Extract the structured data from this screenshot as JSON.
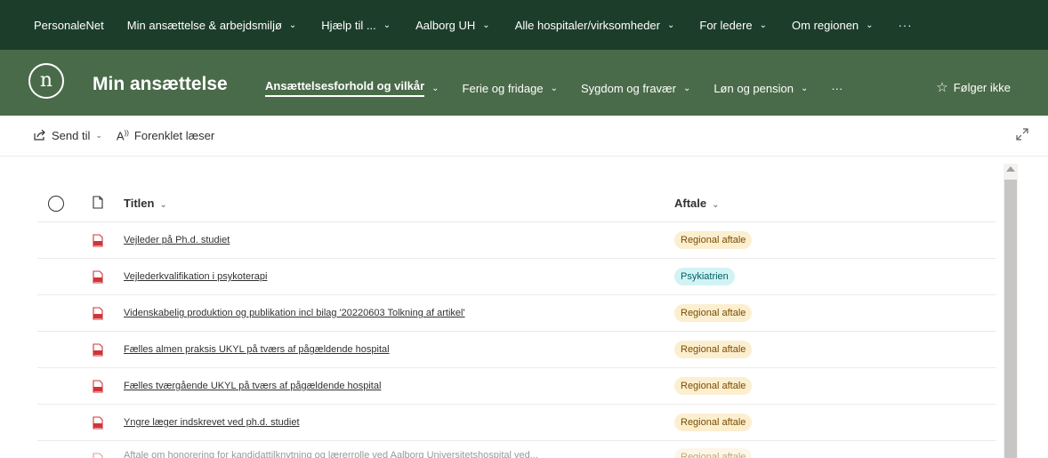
{
  "suitebar": {
    "brand": "PersonaleNet",
    "items": [
      {
        "label": "Min ansættelse & arbejdsmiljø"
      },
      {
        "label": "Hjælp til ..."
      },
      {
        "label": "Aalborg UH"
      },
      {
        "label": "Alle hospitaler/virksomheder"
      },
      {
        "label": "For ledere"
      },
      {
        "label": "Om regionen"
      }
    ],
    "more": "···"
  },
  "site": {
    "logo_letter": "n",
    "title": "Min ansættelse",
    "nav": [
      {
        "label": "Ansættelsesforhold og vilkår",
        "active": true
      },
      {
        "label": "Ferie og fridage"
      },
      {
        "label": "Sygdom og fravær"
      },
      {
        "label": "Løn og pension"
      }
    ],
    "nav_more": "···",
    "follow_label": "Følger ikke"
  },
  "commandbar": {
    "send_label": "Send til",
    "reader_label": "Forenklet læser"
  },
  "list": {
    "columns": {
      "title": "Titlen",
      "agreement": "Aftale"
    },
    "rows": [
      {
        "title": "Vejleder på Ph.d. studiet",
        "agreement": "Regional aftale",
        "type": "regional"
      },
      {
        "title": "Vejlederkvalifikation i psykoterapi",
        "agreement": "Psykiatrien",
        "type": "psyk"
      },
      {
        "title": "Videnskabelig produktion og publikation incl bilag '20220603 Tolkning af artikel'",
        "agreement": "Regional aftale",
        "type": "regional"
      },
      {
        "title": "Fælles almen praksis UKYL på tværs af pågældende hospital",
        "agreement": "Regional aftale",
        "type": "regional"
      },
      {
        "title": "Fælles tværgående UKYL på tværs af pågældende hospital",
        "agreement": "Regional aftale",
        "type": "regional"
      },
      {
        "title": "Yngre læger indskrevet ved ph.d. studiet",
        "agreement": "Regional aftale",
        "type": "regional"
      }
    ],
    "partial_row": {
      "title": "Aftale om honorering for kandidattilknytning og lærerrolle ved Aalborg Universitetshospital ved...",
      "agreement": "Regional aftale"
    }
  },
  "colors": {
    "suitebar_bg": "#1c3d2a",
    "header_bg": "#4a6b49",
    "regional_badge": "#fcefd0",
    "psyk_badge": "#d2f3f4",
    "pdf_red": "#d13438"
  }
}
